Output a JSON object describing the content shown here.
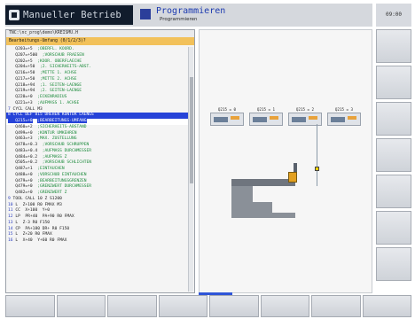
{
  "header": {
    "mode_left": "Manueller Betrieb",
    "mode_right": "Programmieren",
    "mode_right_sub": "Programmieren",
    "clock": "09:00"
  },
  "program": {
    "path": "TNC:\\nc_prog\\demo\\KREISMU.H",
    "title": "Bearbeitungs-Umfang (0/1/2/3)?",
    "lines": [
      {
        "n": "",
        "code": "   Q203=+5",
        "comment": ";OBERFL. KOORD."
      },
      {
        "n": "",
        "code": "   Q207=+500",
        "comment": ";VORSCHUB FRAESEN"
      },
      {
        "n": "",
        "code": "   Q202=+5",
        "comment": ";KOOR. OBERFLAECHE"
      },
      {
        "n": "",
        "code": "   Q204=+50",
        "comment": ";2. SICHERHEITS-ABST."
      },
      {
        "n": "",
        "code": "   Q216=+50",
        "comment": ";MITTE 1. ACHSE"
      },
      {
        "n": "",
        "code": "   Q217=+50",
        "comment": ";MITTE 2. ACHSE"
      },
      {
        "n": "",
        "code": "   Q218=+94",
        "comment": ";1. SEITEN-LAENGE"
      },
      {
        "n": "",
        "code": "   Q219=+94",
        "comment": ";2. SEITEN-LAENGE"
      },
      {
        "n": "",
        "code": "   Q220=+0",
        "comment": ";ECKENRADIUS"
      },
      {
        "n": "",
        "code": "   Q221=+3",
        "comment": ";AUFMASS 1. ACHSE"
      },
      {
        "n": "7",
        "code": " CYCL CALL M3",
        "comment": ""
      },
      {
        "n": "8",
        "code": " CYCL DEF 815 DREHEN KONTUR LAENGS",
        "comment": "",
        "sel": true
      },
      {
        "n": "",
        "code": "   Q215=+0",
        "comment": ";BEARBEITUNGS-UMFANG",
        "sel2": true
      },
      {
        "n": "",
        "code": "   Q460=+2",
        "comment": ";SICHERHEITS-ABSTAND"
      },
      {
        "n": "",
        "code": "   Q499=+0",
        "comment": ";KONTUR UMKEHREN"
      },
      {
        "n": "",
        "code": "   Q463=+3",
        "comment": ";MAX. ZUSTELLUNG"
      },
      {
        "n": "",
        "code": "   Q478=+0.3",
        "comment": ";VORSCHUB SCHRUPPEN"
      },
      {
        "n": "",
        "code": "   Q483=+0.4",
        "comment": ";AUFMASS DURCHMESSER"
      },
      {
        "n": "",
        "code": "   Q484=+0.2",
        "comment": ";AUFMASS Z"
      },
      {
        "n": "",
        "code": "   Q505=+0.2",
        "comment": ";VORSCHUB SCHLICHTEN"
      },
      {
        "n": "",
        "code": "   Q487=+1",
        "comment": ";EINTAUCHEN"
      },
      {
        "n": "",
        "code": "   Q488=+0",
        "comment": ";VORSCHUB EINTAUCHEN"
      },
      {
        "n": "",
        "code": "   Q479=+0",
        "comment": ";BEARBEITUNGSGRENZEN"
      },
      {
        "n": "",
        "code": "   Q479=+0",
        "comment": ";GRENZWERT DURCHMESSER"
      },
      {
        "n": "",
        "code": "   Q482=+0",
        "comment": ";GRENZWERT Z"
      },
      {
        "n": "9",
        "code": " TOOL CALL 10 Z S1200",
        "comment": ""
      },
      {
        "n": "10",
        "code": " L  Z+100 R0 FMAX M3",
        "comment": ""
      },
      {
        "n": "11",
        "code": " CC  X+100  Y+0",
        "comment": ""
      },
      {
        "n": "12",
        "code": " LP  PR+40  PA+90 R0 FMAX",
        "comment": ""
      },
      {
        "n": "13",
        "code": " L  Z-3 R0 F150",
        "comment": ""
      },
      {
        "n": "14",
        "code": " CP  PA+180 DR+ R0 F150",
        "comment": ""
      },
      {
        "n": "15",
        "code": " L  Z+20 R0 FMAX",
        "comment": ""
      },
      {
        "n": "16",
        "code": " L  X+40  Y+60 R0 FMAX",
        "comment": ""
      }
    ]
  },
  "graphic": {
    "strategies": [
      {
        "label": "Q215 = 0"
      },
      {
        "label": "Q215 = 1"
      },
      {
        "label": "Q215 = 2"
      },
      {
        "label": "Q215 = 3"
      }
    ]
  }
}
